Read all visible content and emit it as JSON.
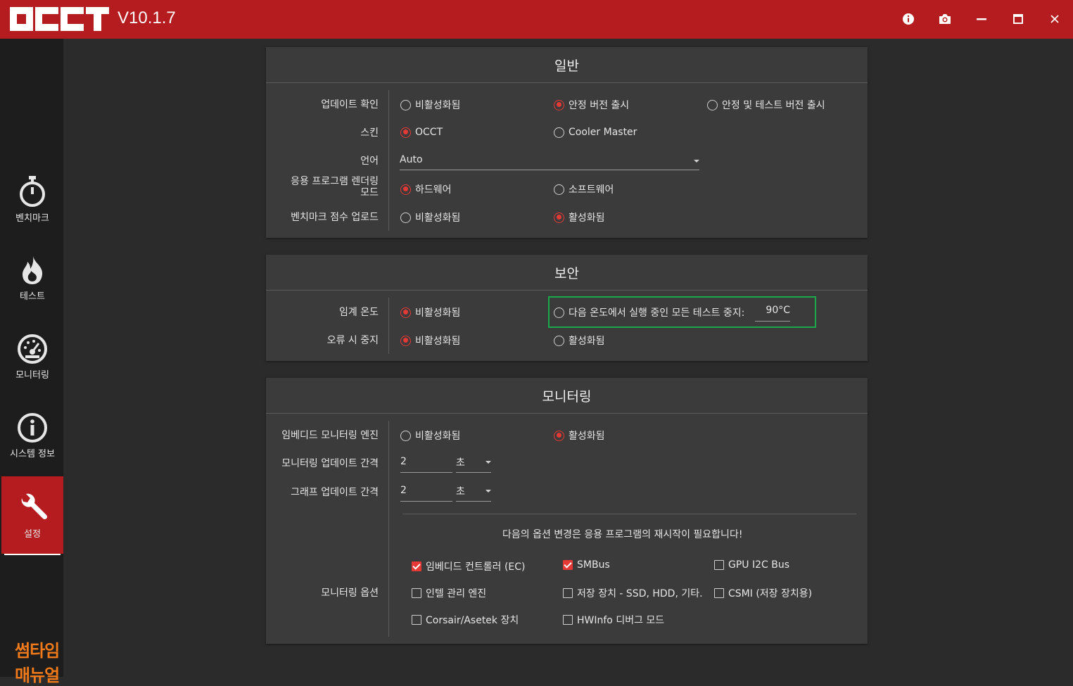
{
  "window": {
    "version": "V10.1.7",
    "logo_text": "OCCT"
  },
  "sidebar": {
    "items": [
      {
        "label": "벤치마크",
        "icon": "stopwatch-icon"
      },
      {
        "label": "테스트",
        "icon": "flame-icon"
      },
      {
        "label": "모니터링",
        "icon": "gauge-icon"
      },
      {
        "label": "시스템 정보",
        "icon": "info-icon"
      },
      {
        "label": "설정",
        "icon": "wrench-icon",
        "active": true
      }
    ],
    "watermark": "썸타임매뉴얼"
  },
  "general": {
    "title": "일반",
    "update_check": {
      "label": "업데이트 확인",
      "options": [
        "비활성화됨",
        "안정 버전 출시",
        "안정 및 테스트 버전 출시"
      ],
      "selected": "안정 버전 출시"
    },
    "skin": {
      "label": "스킨",
      "options": [
        "OCCT",
        "Cooler Master"
      ],
      "selected": "OCCT"
    },
    "language": {
      "label": "언어",
      "value": "Auto"
    },
    "render_mode": {
      "label_line1": "응용 프로그램 렌더링",
      "label_line2": "모드",
      "options": [
        "하드웨어",
        "소프트웨어"
      ],
      "selected": "하드웨어"
    },
    "benchmark_upload": {
      "label": "벤치마크 점수 업로드",
      "options": [
        "비활성화됨",
        "활성화됨"
      ],
      "selected": "활성화됨"
    }
  },
  "security": {
    "title": "보안",
    "critical_temp": {
      "label": "임계 온도",
      "options": [
        "비활성화됨",
        "다음 온도에서 실행 중인 모든 테스트 중지:"
      ],
      "selected": "비활성화됨",
      "temp_value": "90°C"
    },
    "stop_on_error": {
      "label": "오류 시 중지",
      "options": [
        "비활성화됨",
        "활성화됨"
      ],
      "selected": "비활성화됨"
    }
  },
  "monitoring": {
    "title": "모니터링",
    "embedded_engine": {
      "label": "임베디드 모니터링 엔진",
      "options": [
        "비활성화됨",
        "활성화됨"
      ],
      "selected": "활성화됨"
    },
    "monitor_interval": {
      "label": "모니터링 업데이트 간격",
      "value": "2",
      "unit": "초"
    },
    "graph_interval": {
      "label": "그래프 업데이트 간격",
      "value": "2",
      "unit": "초"
    },
    "restart_notice": "다음의 옵션 변경은 응용 프로그램의 재시작이 필요합니다!",
    "options_label": "모니터링 옵션",
    "options": [
      {
        "label": "임베디드 컨트롤러 (EC)",
        "checked": true
      },
      {
        "label": "SMBus",
        "checked": true
      },
      {
        "label": "GPU I2C Bus",
        "checked": false
      },
      {
        "label": "인텔 관리 엔진",
        "checked": false
      },
      {
        "label": "저장 장치 - SSD, HDD, 기타.",
        "checked": false
      },
      {
        "label": "CSMI (저장 장치용)",
        "checked": false
      },
      {
        "label": "Corsair/Asetek 장치",
        "checked": false
      },
      {
        "label": "HWInfo 디버그 모드",
        "checked": false
      }
    ]
  },
  "colors": {
    "accent": "#b51c1f",
    "radio_on": "#e53935",
    "highlight": "#1aa84a",
    "watermark": "#f07a1a"
  }
}
